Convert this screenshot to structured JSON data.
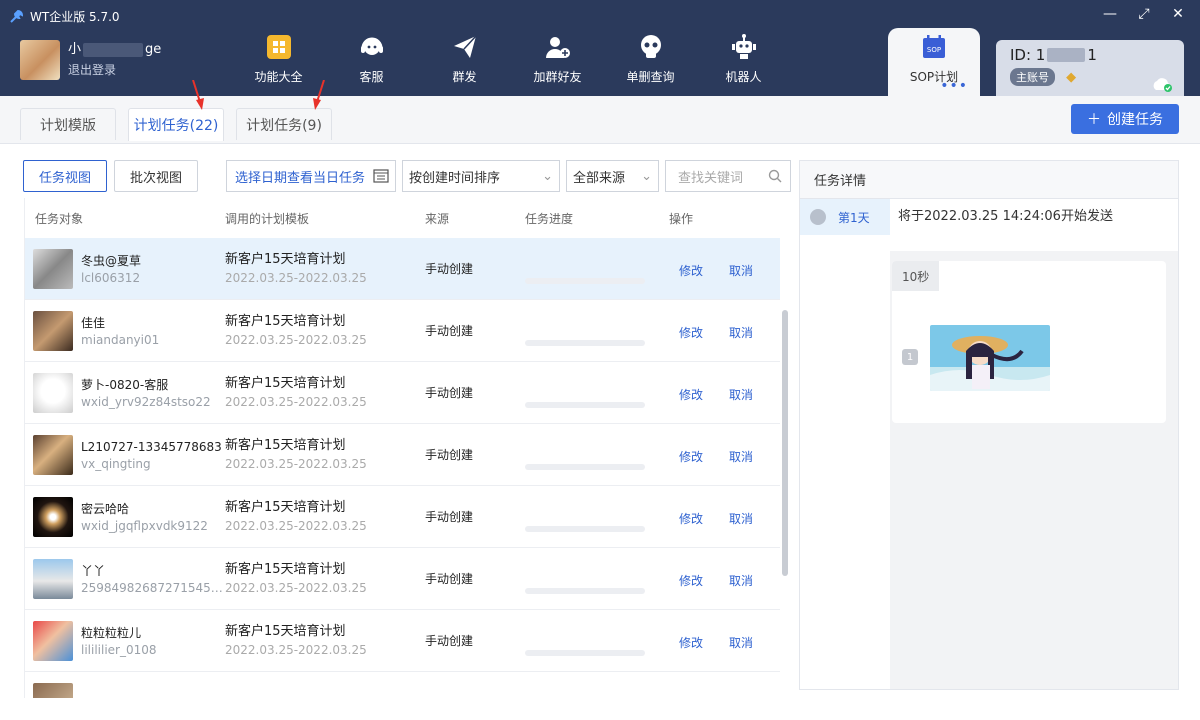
{
  "app": {
    "title": "WT企业版 5.7.0"
  },
  "user": {
    "name_prefix": "小",
    "name_suffix": "ge",
    "logout": "退出登录"
  },
  "nav": [
    {
      "label": "功能大全",
      "icon": "grid-icon"
    },
    {
      "label": "客服",
      "icon": "headset-icon"
    },
    {
      "label": "群发",
      "icon": "send-icon"
    },
    {
      "label": "加群好友",
      "icon": "add-friend-icon"
    },
    {
      "label": "单删查询",
      "icon": "skull-icon"
    },
    {
      "label": "机器人",
      "icon": "robot-icon"
    },
    {
      "label": "SOP计划",
      "icon": "sop-calendar-icon",
      "icon_text": "SOP"
    }
  ],
  "account": {
    "id_prefix": "ID: 1",
    "id_suffix": "1",
    "badge": "主账号"
  },
  "tabs": [
    {
      "label": "计划模版"
    },
    {
      "label": "计划任务(22)"
    },
    {
      "label": "计划任务(9)"
    }
  ],
  "create_task": "创建任务",
  "toolbar": {
    "task_view": "任务视图",
    "batch_view": "批次视图",
    "date_select": "选择日期查看当日任务",
    "sort_select": "按创建时间排序",
    "source_select": "全部来源",
    "search_placeholder": "查找关键词"
  },
  "table": {
    "headers": [
      "任务对象",
      "调用的计划模板",
      "来源",
      "任务进度",
      "操作"
    ],
    "rows": [
      {
        "name": "冬虫@夏草",
        "id": "lcl606312",
        "template": "新客户15天培育计划",
        "date": "2022.03.25-2022.03.25",
        "source": "手动创建",
        "progress": 0,
        "edit": "修改",
        "cancel": "取消"
      },
      {
        "name": "佳佳",
        "id": "miandanyi01",
        "template": "新客户15天培育计划",
        "date": "2022.03.25-2022.03.25",
        "source": "手动创建",
        "progress": 0,
        "edit": "修改",
        "cancel": "取消"
      },
      {
        "name": "萝卜-0820-客服",
        "id": "wxid_yrv92z84stso22",
        "template": "新客户15天培育计划",
        "date": "2022.03.25-2022.03.25",
        "source": "手动创建",
        "progress": 0,
        "edit": "修改",
        "cancel": "取消"
      },
      {
        "name": "L210727-13345778683",
        "id": "vx_qingting",
        "template": "新客户15天培育计划",
        "date": "2022.03.25-2022.03.25",
        "source": "手动创建",
        "progress": 0,
        "edit": "修改",
        "cancel": "取消"
      },
      {
        "name": "密云哈哈",
        "id": "wxid_jgqflpxvdk9122",
        "template": "新客户15天培育计划",
        "date": "2022.03.25-2022.03.25",
        "source": "手动创建",
        "progress": 0,
        "edit": "修改",
        "cancel": "取消"
      },
      {
        "name": "丫丫",
        "id": "25984982687271545@...",
        "template": "新客户15天培育计划",
        "date": "2022.03.25-2022.03.25",
        "source": "手动创建",
        "progress": 0,
        "edit": "修改",
        "cancel": "取消"
      },
      {
        "name": "粒粒粒粒儿",
        "id": "lilililier_0108",
        "template": "新客户15天培育计划",
        "date": "2022.03.25-2022.03.25",
        "source": "手动创建",
        "progress": 0,
        "edit": "修改",
        "cancel": "取消"
      }
    ]
  },
  "detail": {
    "title": "任务详情",
    "day": "第1天",
    "send_time": "将于2022.03.25 14:24:06开始发送",
    "delay": "10秒",
    "msg_no": "1"
  },
  "colors": {
    "topbar": "#2b3a5c",
    "accent": "#3a6fe0",
    "link": "#2f62d0"
  }
}
